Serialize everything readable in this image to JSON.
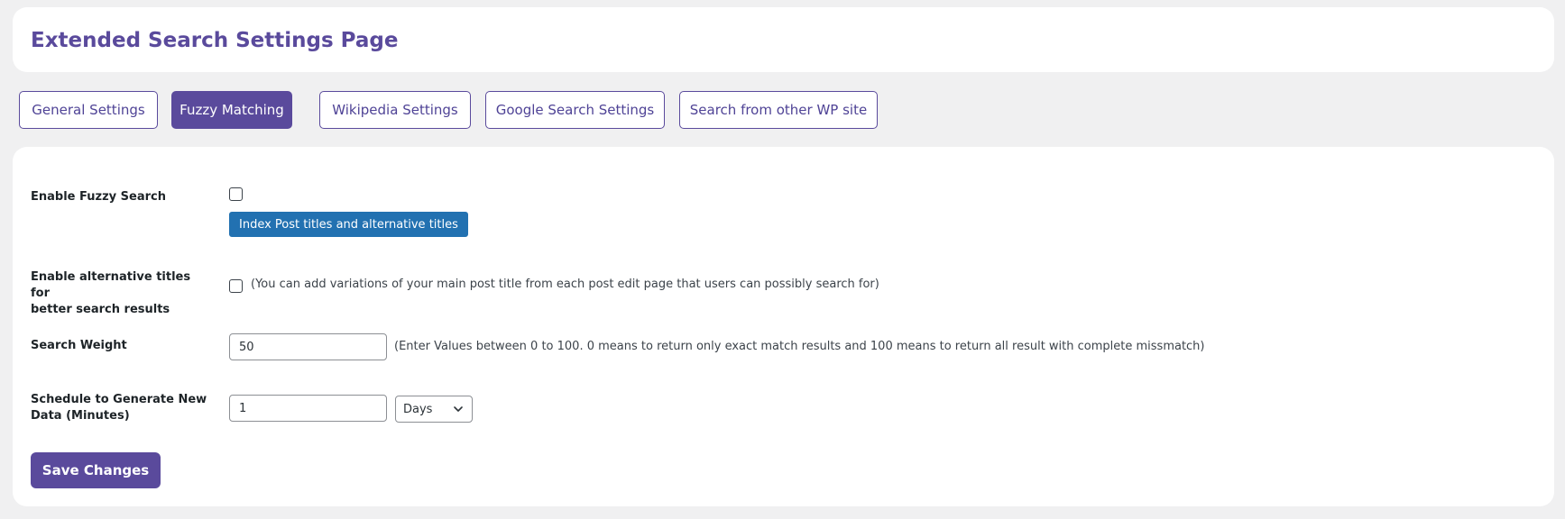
{
  "header": {
    "title": "Extended Search Settings Page"
  },
  "tabs": [
    {
      "label": "General Settings"
    },
    {
      "label": "Fuzzy Matching"
    },
    {
      "label": "Wikipedia Settings"
    },
    {
      "label": "Google Search Settings"
    },
    {
      "label": "Search from other WP site"
    }
  ],
  "active_tab": "Fuzzy Matching",
  "settings": {
    "fuzzy": {
      "label": "Enable Fuzzy Search",
      "checked": false,
      "index_button": "Index Post titles and alternative titles"
    },
    "alt_titles": {
      "label_line1": "Enable alternative titles for",
      "label_line2": "better search results",
      "checked": false,
      "hint": "(You can add variations of your main post title from each post edit page that users can possibly search for)"
    },
    "weight": {
      "label": "Search Weight",
      "value": "50",
      "hint": "(Enter Values between 0 to 100. 0 means to return only exact match results and 100 means to return all result with complete missmatch)"
    },
    "schedule": {
      "label_line1": "Schedule to Generate New",
      "label_line2": "Data (Minutes)",
      "value": "1",
      "unit": "Days"
    }
  },
  "save_label": "Save Changes",
  "colors": {
    "accent": "#5a4a9c",
    "primary_button": "#2271b1",
    "background": "#f0f0f1"
  }
}
